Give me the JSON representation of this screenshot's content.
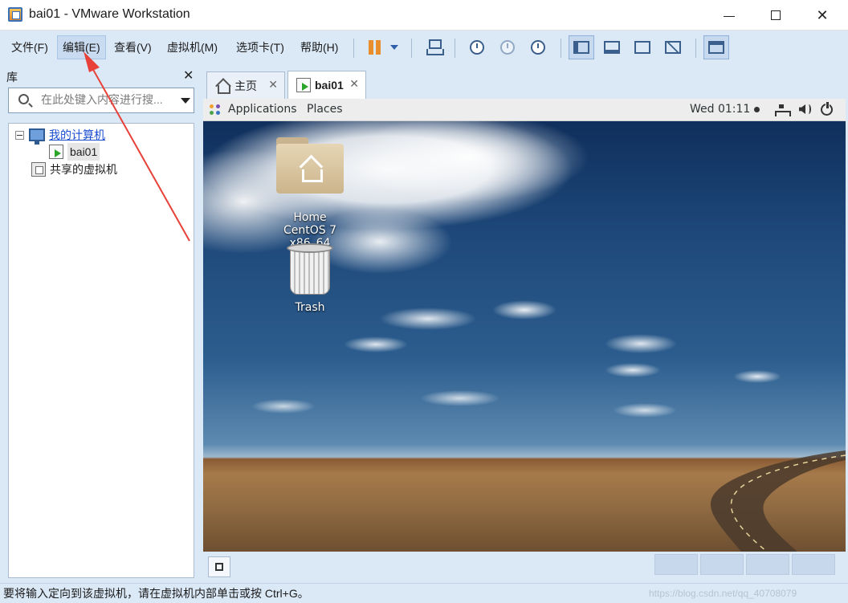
{
  "window": {
    "title": "bai01 - VMware Workstation",
    "minimize_glyph": "",
    "maximize_glyph": "",
    "close_glyph": "✕"
  },
  "menu": {
    "file": "文件(F)",
    "edit": "编辑(E)",
    "view": "查看(V)",
    "vm": "虚拟机(M)",
    "tabs": "选项卡(T)",
    "help": "帮助(H)"
  },
  "library": {
    "title": "库",
    "close_glyph": "✕",
    "search_placeholder": "在此处键入内容进行搜...",
    "tree": {
      "my_computer": "我的计算机",
      "vm_name": "bai01",
      "shared_vms": "共享的虚拟机"
    }
  },
  "tabs": [
    {
      "label": "主页",
      "close": "✕"
    },
    {
      "label": "bai01",
      "close": "✕"
    }
  ],
  "guest": {
    "topbar": {
      "applications": "Applications",
      "places": "Places",
      "clock": "Wed 01:11"
    },
    "desktop_icons": {
      "home_label": "Home",
      "cdrom_label": "CentOS 7 x86_64",
      "trash_label": "Trash"
    }
  },
  "statusbar": {
    "text": "要将输入定向到该虚拟机，请在虚拟机内部单击或按 Ctrl+G。",
    "watermark": "https://blog.csdn.net/qq_40708079"
  },
  "colors": {
    "accent": "#2e5fa8",
    "chrome": "#dbe8f6",
    "pause": "#e88e2d",
    "arrow": "#e8413a"
  },
  "icons": {
    "app": "vmware-icon",
    "pause": "pause-icon",
    "send_keys": "send-ctrl-alt-del-icon",
    "snapshot": "snapshot-icon",
    "revert": "revert-snapshot-icon",
    "manager": "snapshot-manager-icon",
    "sidebar": "show-library-icon",
    "console": "console-view-icon",
    "fullscreen": "fullscreen-icon",
    "unity": "unity-icon",
    "thumbnail": "thumbnail-icon"
  }
}
